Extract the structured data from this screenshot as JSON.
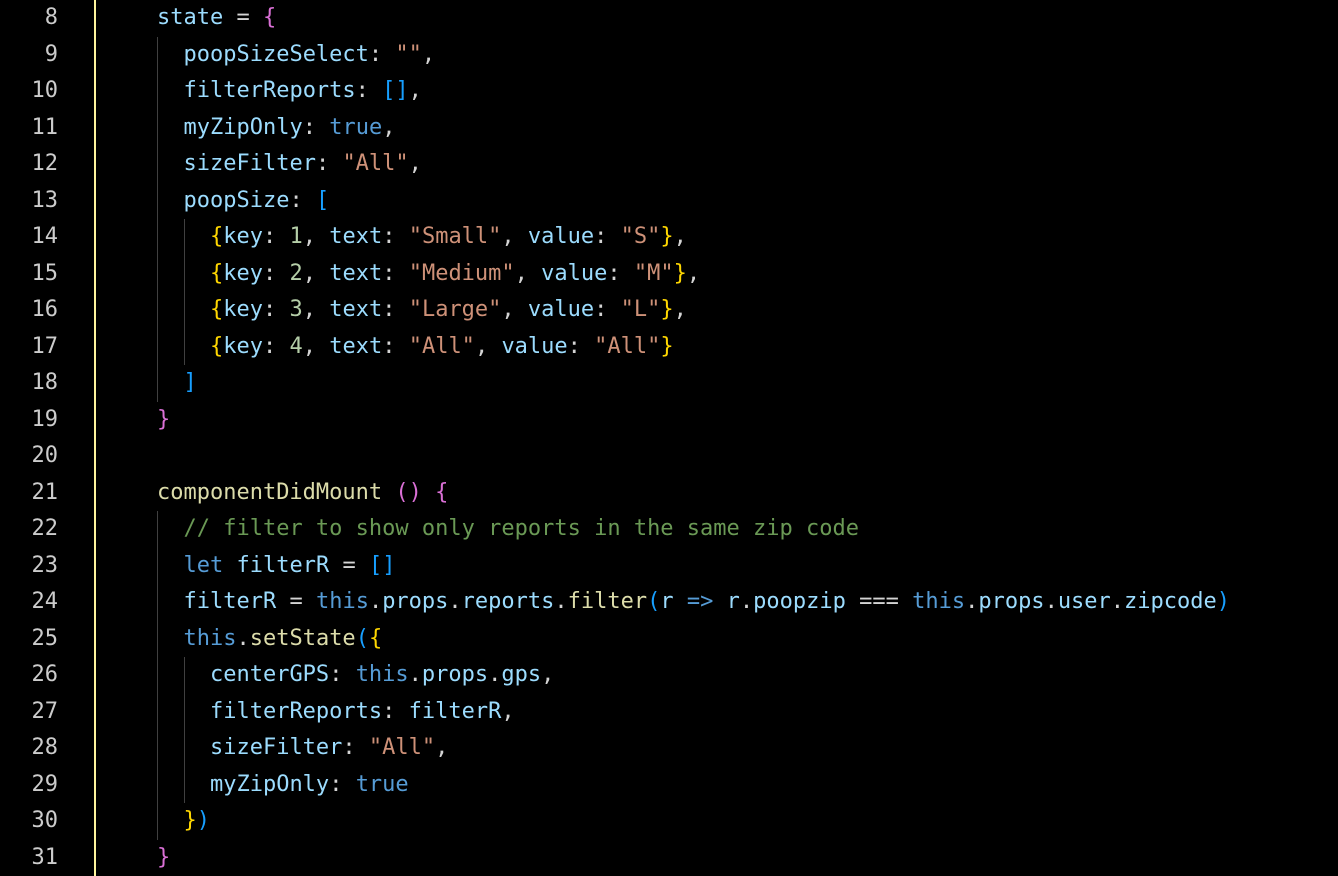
{
  "lineNumbers": [
    "8",
    "9",
    "10",
    "11",
    "12",
    "13",
    "14",
    "15",
    "16",
    "17",
    "18",
    "19",
    "20",
    "21",
    "22",
    "23",
    "24",
    "25",
    "26",
    "27",
    "28",
    "29",
    "30",
    "31"
  ],
  "tokens": {
    "state": "state",
    "eq": " = ",
    "lbrace_p": "{",
    "rbrace_p": "}",
    "lbrace_y": "{",
    "rbrace_y": "}",
    "lbrace_b": "{",
    "rbrace_b": "}",
    "lbrack_b": "[",
    "rbrack_b": "]",
    "lbrack_y": "[",
    "rbrack_y": "]",
    "lparen_y": "(",
    "rparen_y": ")",
    "lparen_p": "(",
    "rparen_p": ")",
    "poopSizeSelect": "poopSizeSelect",
    "filterReports": "filterReports",
    "myZipOnly": "myZipOnly",
    "sizeFilter": "sizeFilter",
    "poopSize": "poopSize",
    "key": "key",
    "text": "text",
    "value": "value",
    "centerGPS": "centerGPS",
    "colon": ":",
    "comma": ",",
    "dot": ".",
    "emptyStr": "\"\"",
    "emptyArr": "[]",
    "true": "true",
    "all": "\"All\"",
    "small": "\"Small\"",
    "medium": "\"Medium\"",
    "large": "\"Large\"",
    "allVal": "\"All\"",
    "s": "\"S\"",
    "m": "\"M\"",
    "l": "\"L\"",
    "n1": "1",
    "n2": "2",
    "n3": "3",
    "n4": "4",
    "componentDidMount": "componentDidMount",
    "comment22": "// filter to show only reports in the same zip code",
    "let": "let",
    "filterR": "filterR",
    "this": "this",
    "props": "props",
    "reports": "reports",
    "filter": "filter",
    "r": "r",
    "arrow": "=>",
    "poopzip": "poopzip",
    "eqeqeq": "===",
    "user": "user",
    "zipcode": "zipcode",
    "setState": "setState",
    "gps": "gps"
  }
}
